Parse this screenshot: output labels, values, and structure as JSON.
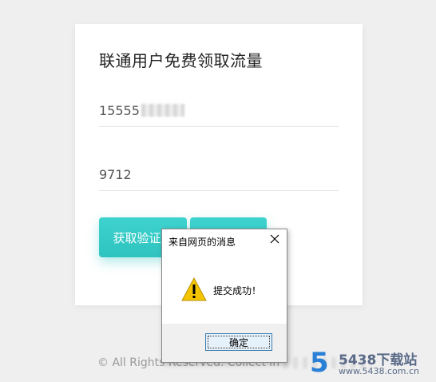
{
  "form": {
    "title": "联通用户免费领取流量",
    "phone_value": "15555",
    "code_value": "9712",
    "get_code_label": "获取验证码",
    "submit_label": ""
  },
  "footer": {
    "text": "© All Rights Reserved. Collect in"
  },
  "watermark": {
    "digit": "5",
    "title": "5438下载站",
    "url": "www.5438.com.cn"
  },
  "dialog": {
    "title": "来自网页的消息",
    "message": "提交成功！",
    "ok_label": "确定"
  },
  "colors": {
    "accent": "#2ec3bf",
    "background": "#efefef"
  }
}
